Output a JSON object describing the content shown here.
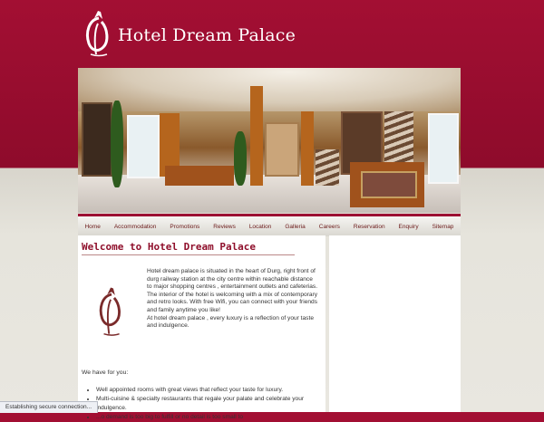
{
  "header": {
    "title": "Hotel Dream Palace"
  },
  "nav": {
    "items": [
      "Home",
      "Accommodation",
      "Promotions",
      "Reviews",
      "Location",
      "Galleria",
      "Careers",
      "Reservation",
      "Enquiry",
      "Sitemap"
    ]
  },
  "main": {
    "heading": "Welcome to Hotel Dream Palace",
    "intro_p1": "Hotel dream palace is situated in the heart of Durg, right front of durg railway station at the city centre within reachable distance to major shopping centres , entertainment outlets and cafeterias. The interior of the hotel is welcoming with a mix of contemporary and retro looks. With free Wifi, you can connect with your friends and family anytime you like!",
    "intro_p2": "At hotel dream palace , every luxury is a reflection of your taste and indulgence.",
    "have_for_you": "We have for you:",
    "features": [
      "Well appointed rooms with great views that reflect your taste for luxury.",
      "Multi-cuisine & specialty restaurants that regale your palate and celebrate your indulgence.",
      "...o demand is too big to fulfill or no detail is too small to"
    ]
  },
  "status_bar": {
    "text": "Establishing secure connection..."
  },
  "colors": {
    "brand": "#9c1033",
    "nav_text": "#6b1a1a",
    "background": "#e9e7e0"
  }
}
